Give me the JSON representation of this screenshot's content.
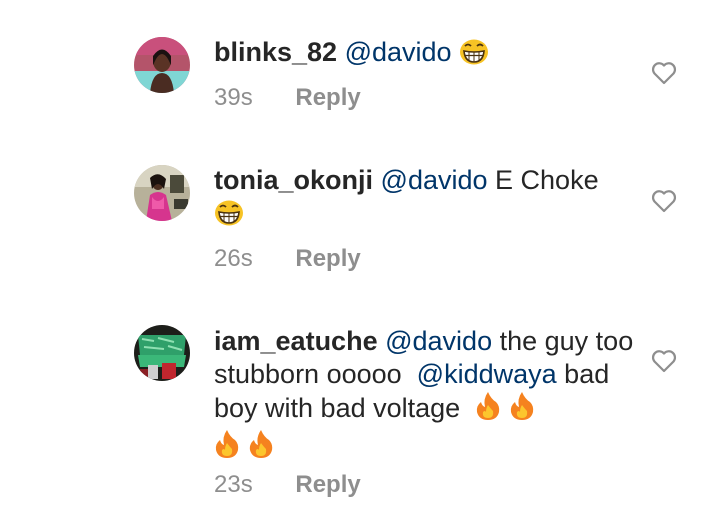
{
  "comments": [
    {
      "username": "blinks_82",
      "mention": "@davido",
      "text": "",
      "time": "39s",
      "reply": "Reply",
      "emoji": "grinning-squinting-face"
    },
    {
      "username": "tonia_okonji",
      "mention": "@davido",
      "text": "E Choke",
      "time": "26s",
      "reply": "Reply",
      "emoji": "grinning-squinting-face"
    },
    {
      "username": "iam_eatuche",
      "mention": "@davido",
      "text": "the guy too stubborn ooooo",
      "mention2": "@kiddwaya",
      "text2": "bad boy with bad voltage",
      "time": "23s",
      "reply": "Reply",
      "emoji": "fire"
    }
  ],
  "colors": {
    "mention": "#003569",
    "meta": "#8e8e8e",
    "text": "#262626"
  },
  "icons": {
    "like": "heart-outline-icon"
  }
}
